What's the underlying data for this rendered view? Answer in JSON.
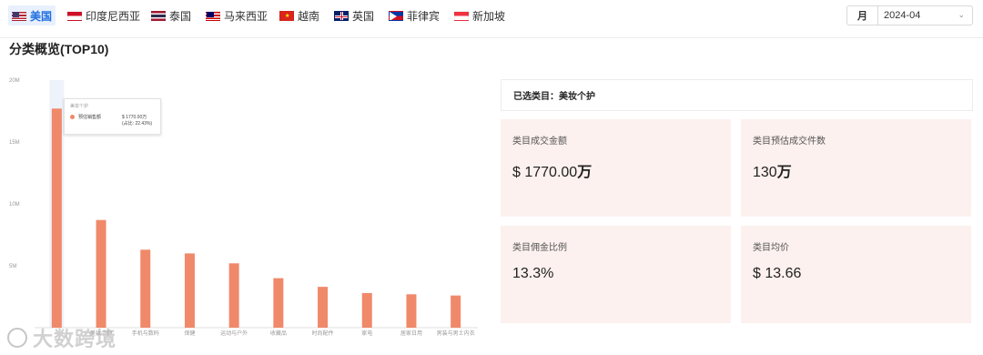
{
  "countries": [
    {
      "label": "美国",
      "flag": "us-flag-icon",
      "active": true
    },
    {
      "label": "印度尼西亚",
      "flag": "indonesia-flag-icon",
      "active": false
    },
    {
      "label": "泰国",
      "flag": "thailand-flag-icon",
      "active": false
    },
    {
      "label": "马来西亚",
      "flag": "malaysia-flag-icon",
      "active": false
    },
    {
      "label": "越南",
      "flag": "vietnam-flag-icon",
      "active": false
    },
    {
      "label": "英国",
      "flag": "uk-flag-icon",
      "active": false
    },
    {
      "label": "菲律宾",
      "flag": "philippines-flag-icon",
      "active": false
    },
    {
      "label": "新加坡",
      "flag": "singapore-flag-icon",
      "active": false
    }
  ],
  "period": {
    "type_label": "月",
    "value": "2024-04"
  },
  "section_title": "分类概览(TOP10)",
  "chart_data": {
    "type": "bar",
    "categories": [
      "美妆个护",
      "手机与数码",
      "保健",
      "运动与户外",
      "收藏品",
      "时尚配件",
      "家电",
      "居家日用",
      "男装与男士内衣"
    ],
    "values": [
      17700000,
      8700000,
      6300000,
      6000000,
      5200000,
      4000000,
      3300000,
      2800000,
      2700000,
      2600000
    ],
    "tick_labels": [
      "20M",
      "15M",
      "10M",
      "5M"
    ],
    "ylim": [
      0,
      20000000
    ],
    "bar_color": "#f0896a",
    "highlight_index": 0,
    "xlabel": "",
    "ylabel": ""
  },
  "tooltip": {
    "title": "美妆个护",
    "series_label": "预估销售额",
    "value": "$ 1770.00万",
    "share": "(占比: 22.43%)",
    "color": "#f0896a"
  },
  "watermark": "大数跨境",
  "selected": {
    "text": "已选类目：美妆个护"
  },
  "cards": [
    {
      "label": "类目成交金额",
      "value": "$ 1770.00",
      "unit": "万"
    },
    {
      "label": "类目预估成交件数",
      "value": "130",
      "unit": "万"
    },
    {
      "label": "类目佣金比例",
      "value": "13.3%",
      "unit": ""
    },
    {
      "label": "类目均价",
      "value": "$ 13.66",
      "unit": ""
    }
  ]
}
